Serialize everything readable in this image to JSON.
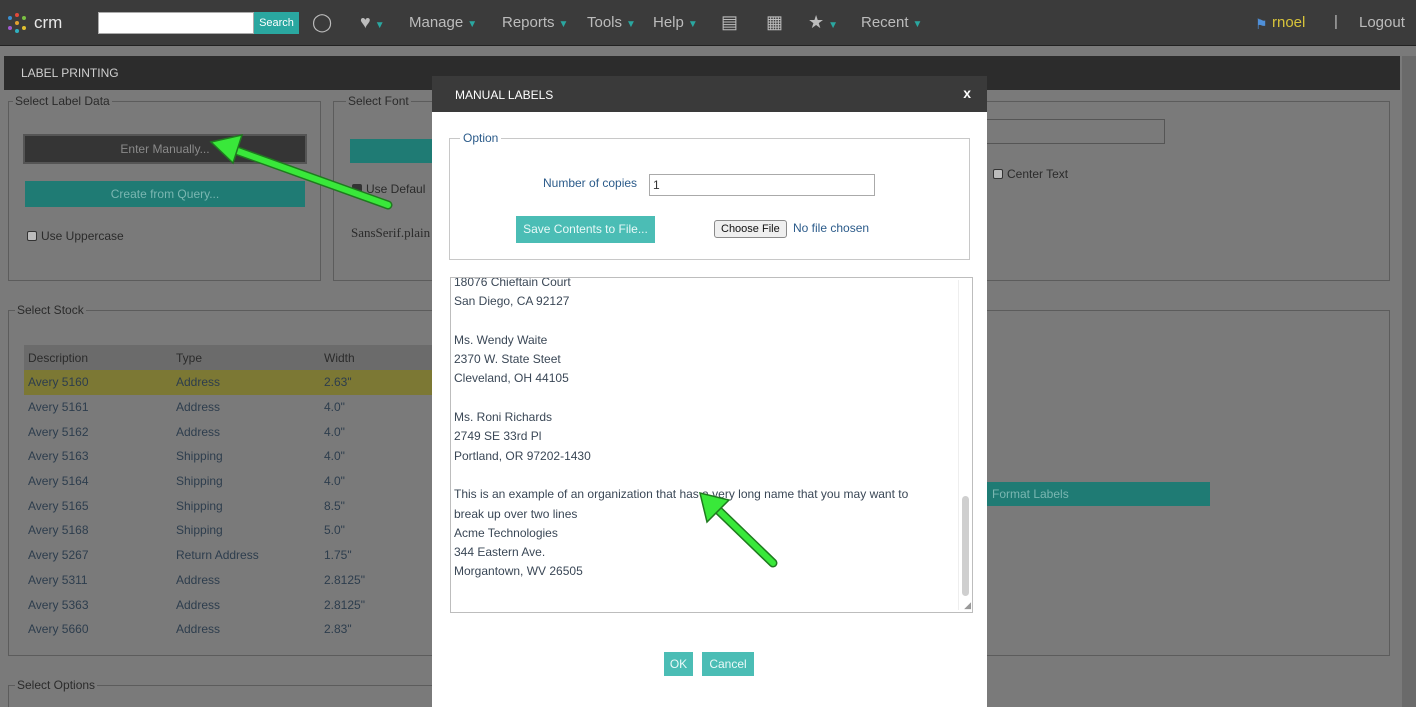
{
  "nav": {
    "brand": "crm",
    "search_placeholder": "",
    "search_button": "Search",
    "menu": [
      "Manage",
      "Reports",
      "Tools",
      "Help",
      "Recent"
    ],
    "user": "rnoel",
    "separator": "|",
    "logout": "Logout"
  },
  "page": {
    "title": "LABEL PRINTING",
    "select_label_data": {
      "legend": "Select Label Data",
      "enter_manually": "Enter Manually...",
      "create_from_query": "Create from Query...",
      "use_uppercase": "Use Uppercase"
    },
    "select_font": {
      "legend": "Select Font",
      "use_default": "Use Defaul",
      "font_name": "SansSerif.plain"
    },
    "center_text": "Center Text",
    "format_labels": "Format Labels",
    "select_stock": {
      "legend": "Select Stock",
      "headers": [
        "Description",
        "Type",
        "Width"
      ],
      "rows": [
        [
          "Avery 5160",
          "Address",
          "2.63\""
        ],
        [
          "Avery 5161",
          "Address",
          "4.0\""
        ],
        [
          "Avery 5162",
          "Address",
          "4.0\""
        ],
        [
          "Avery 5163",
          "Shipping",
          "4.0\""
        ],
        [
          "Avery 5164",
          "Shipping",
          "4.0\""
        ],
        [
          "Avery 5165",
          "Shipping",
          "8.5\""
        ],
        [
          "Avery 5168",
          "Shipping",
          "5.0\""
        ],
        [
          "Avery 5267",
          "Return Address",
          "1.75\""
        ],
        [
          "Avery 5311",
          "Address",
          "2.8125\""
        ],
        [
          "Avery 5363",
          "Address",
          "2.8125\""
        ],
        [
          "Avery 5660",
          "Address",
          "2.83\""
        ]
      ]
    },
    "select_options": {
      "legend": "Select Options"
    }
  },
  "modal": {
    "title": "MANUAL LABELS",
    "close": "x",
    "option_legend": "Option",
    "copies_label": "Number of copies",
    "copies_value": "1",
    "save_button": "Save Contents to File...",
    "choose_file": "Choose File",
    "no_file": "No file chosen",
    "text_lines": [
      "18076 Chieftain Court",
      "San Diego, CA  92127",
      "",
      "Ms. Wendy Waite",
      "2370 W. State Steet",
      "Cleveland, OH  44105",
      "",
      "Ms. Roni Richards",
      "2749 SE 33rd Pl",
      "Portland, OR  97202-1430",
      "",
      "This is an example of an organization that has a very long name that you may want to",
      "break up over two lines",
      "Acme Technologies",
      "344 Eastern Ave.",
      "Morgantown, WV  26505"
    ],
    "ok": "OK",
    "cancel": "Cancel"
  },
  "colors": {
    "accent": "#4bbdb5",
    "arrow": "#39e83a",
    "nav_bg": "#3b3b3b"
  }
}
